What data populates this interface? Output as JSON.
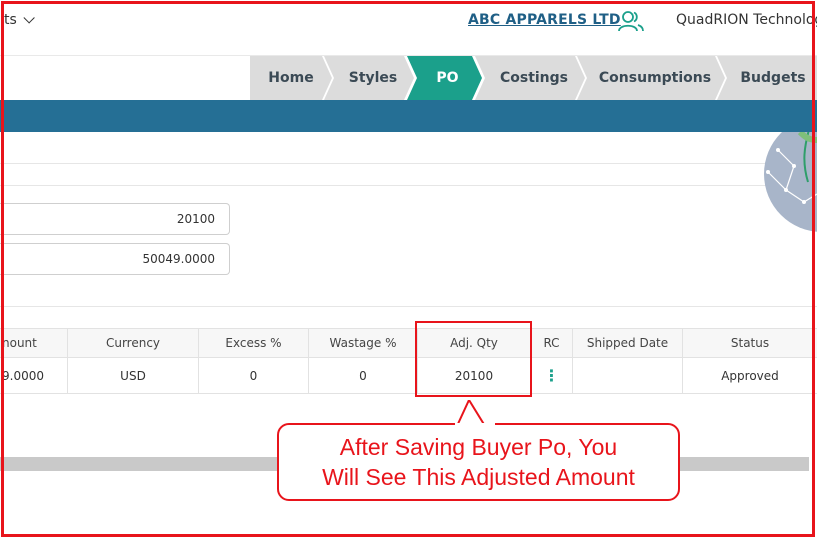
{
  "header": {
    "menu_label": "ts",
    "company_name": "ABC APPARELS LTD",
    "tenant_name": "QuadRION Technologies"
  },
  "breadcrumbs": [
    {
      "label": "Home",
      "active": false
    },
    {
      "label": "Styles",
      "active": false
    },
    {
      "label": "PO",
      "active": true
    },
    {
      "label": "Costings",
      "active": false
    },
    {
      "label": "Consumptions",
      "active": false
    },
    {
      "label": "Budgets",
      "active": false
    }
  ],
  "fields": {
    "quantity_value": "20100",
    "amount_value": "50049.0000"
  },
  "table": {
    "columns": [
      "nount",
      "Currency",
      "Excess %",
      "Wastage %",
      "Adj. Qty",
      "RC",
      "Shipped Date",
      "Status"
    ],
    "rows": [
      [
        "9.0000",
        "USD",
        "0",
        "0",
        "20100",
        "⋮",
        "",
        "Approved"
      ]
    ]
  },
  "callout": {
    "line1": "After Saving Buyer Po, You",
    "line2": "Will See This Adjusted Amount"
  },
  "colors": {
    "accent": "#1ba08b",
    "band": "#256f95",
    "annotation": "#e8141b"
  }
}
